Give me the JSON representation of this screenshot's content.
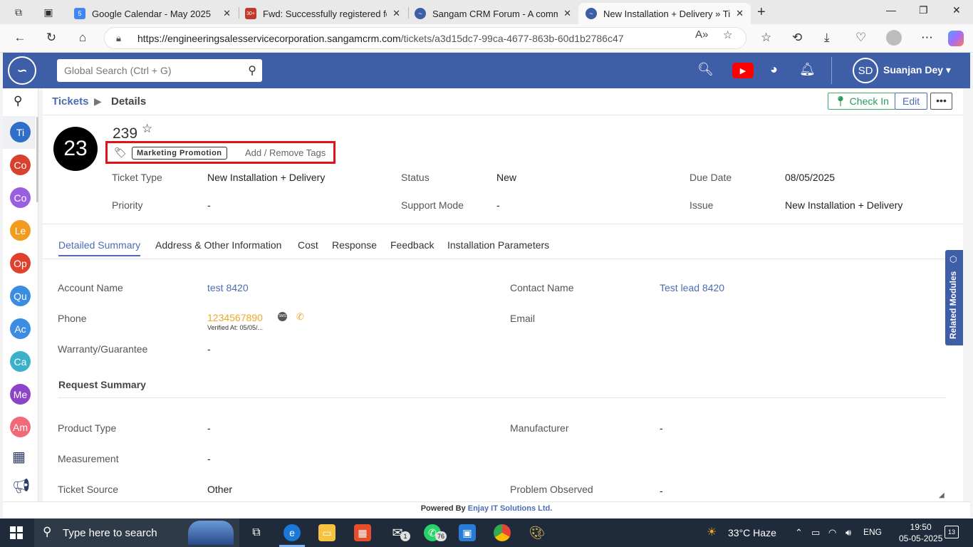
{
  "browser": {
    "tabs": [
      {
        "title": "Google Calendar - May 2025",
        "icon": "calendar-icon",
        "icon_text": "5",
        "color": "#4285f4"
      },
      {
        "title": "Fwd: Successfully registered for \"F",
        "icon": "mail-icon",
        "icon_text": "30+",
        "color": "#c0392b"
      },
      {
        "title": "Sangam CRM Forum - A commun",
        "icon": "sangam-icon",
        "icon_text": "",
        "color": "#3f5ea8"
      },
      {
        "title": "New Installation + Delivery » Tick",
        "icon": "sangam-icon",
        "icon_text": "",
        "color": "#3f5ea8"
      }
    ],
    "url_host": "https://engineeringsalesservicecorporation.sangamcrm.com",
    "url_path": "/tickets/a3d15dc7-99ca-4677-863b-60d1b2786c47"
  },
  "header": {
    "search_placeholder": "Global Search (Ctrl + G)",
    "user_initials": "SD",
    "user_name": "Suanjan Dey"
  },
  "rail": {
    "items": [
      {
        "label": "Ti",
        "color": "#2f6fc9"
      },
      {
        "label": "Co",
        "color": "#d9412f"
      },
      {
        "label": "Co",
        "color": "#9a5ee0"
      },
      {
        "label": "Le",
        "color": "#f29b1d"
      },
      {
        "label": "Op",
        "color": "#e0412f"
      },
      {
        "label": "Qu",
        "color": "#3a8de0"
      },
      {
        "label": "Ac",
        "color": "#3a8de0"
      },
      {
        "label": "Ca",
        "color": "#3ab0c9"
      },
      {
        "label": "Me",
        "color": "#8e44c9"
      },
      {
        "label": "Am",
        "color": "#f06a7a"
      }
    ]
  },
  "breadcrumb": {
    "root": "Tickets",
    "current": "Details"
  },
  "actions": {
    "checkin": "Check In",
    "edit": "Edit",
    "more": "•••"
  },
  "ticket": {
    "avatar": "23",
    "number": "239",
    "tag": "Marketing Promotion",
    "tag_action": "Add / Remove Tags",
    "fields": {
      "ticket_type_label": "Ticket Type",
      "ticket_type": "New Installation + Delivery",
      "status_label": "Status",
      "status": "New",
      "due_date_label": "Due Date",
      "due_date": "08/05/2025",
      "priority_label": "Priority",
      "priority": "-",
      "support_mode_label": "Support Mode",
      "support_mode": "-",
      "issue_label": "Issue",
      "issue": "New Installation + Delivery"
    }
  },
  "detail_tabs": [
    "Detailed Summary",
    "Address & Other Information",
    "Cost",
    "Response",
    "Feedback",
    "Installation Parameters"
  ],
  "summary": {
    "account_name_label": "Account Name",
    "account_name": "test 8420",
    "contact_name_label": "Contact Name",
    "contact_name": "Test lead 8420",
    "phone_label": "Phone",
    "phone": "1234567890",
    "phone_verified": "Verified At: 05/05/...",
    "email_label": "Email",
    "warranty_label": "Warranty/Guarantee",
    "warranty": "-",
    "request_summary_title": "Request Summary",
    "product_type_label": "Product Type",
    "product_type": "-",
    "manufacturer_label": "Manufacturer",
    "manufacturer": "-",
    "measurement_label": "Measurement",
    "measurement": "-",
    "ticket_source_label": "Ticket Source",
    "ticket_source": "Other",
    "problem_observed_label": "Problem Observed",
    "problem_observed": "-"
  },
  "related_modules": "Related Modules",
  "footer": {
    "prefix": "Powered By",
    "company": "Enjay IT Solutions Ltd."
  },
  "taskbar": {
    "search_text": "Type here to search",
    "whatsapp_badge": "76",
    "mail_badge": "1",
    "weather": "33°C  Haze",
    "lang": "ENG",
    "time": "19:50",
    "date": "05-05-2025",
    "notifications": "13"
  }
}
